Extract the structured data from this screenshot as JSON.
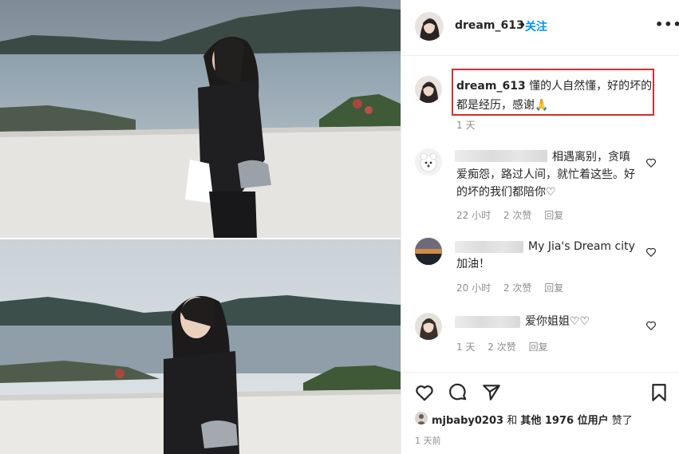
{
  "post": {
    "photos": [
      {
        "alt": "photo-1"
      },
      {
        "alt": "photo-2"
      }
    ]
  },
  "header": {
    "username": "dream_613",
    "separator": "•",
    "follow_label": "关注",
    "more_label": "•••"
  },
  "caption": {
    "username": "dream_613",
    "text": "懂的人自然懂，好的坏的都是经历，感谢🙏",
    "time": "1 天"
  },
  "comments": [
    {
      "text": "相遇离别，贪嗔爱痴怨，路过人间，就忙着这些。好的坏的我们都陪你♡",
      "time": "22 小时",
      "likes": "2 次赞",
      "reply": "回复"
    },
    {
      "text": "My Jia's Dream city 加油！",
      "time": "20 小时",
      "likes": "2 次赞",
      "reply": "回复"
    },
    {
      "text": "爱你姐姐♡♡",
      "time": "1 天",
      "likes": "2 次赞",
      "reply": "回复"
    }
  ],
  "actions": {
    "like_icon": "heart-outline-icon",
    "comment_icon": "comment-bubble-icon",
    "share_icon": "paper-plane-icon",
    "save_icon": "bookmark-icon"
  },
  "likes": {
    "first_user": "mjbaby0203",
    "joiner": "和",
    "others": "其他 1976 位用户",
    "suffix": "赞了"
  },
  "post_time": "1 天前",
  "colors": {
    "follow_blue": "#0095f6",
    "highlight_red": "#d32f2f",
    "meta_grey": "#8e8e8e",
    "text_dark": "#262626"
  }
}
